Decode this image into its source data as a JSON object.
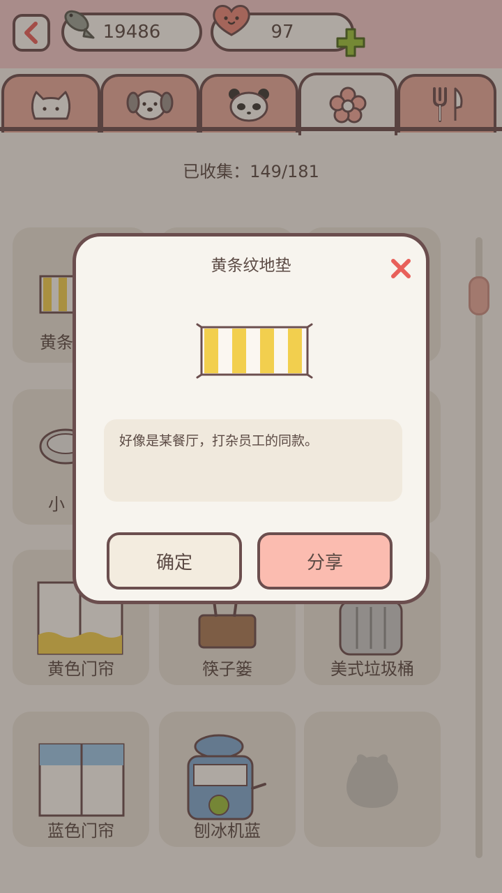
{
  "header": {
    "fish_count": "19486",
    "heart_count": "97"
  },
  "tabs": [
    {
      "icon": "cat-face-icon"
    },
    {
      "icon": "dog-face-icon"
    },
    {
      "icon": "panda-face-icon"
    },
    {
      "icon": "flower-icon",
      "active": true
    },
    {
      "icon": "fork-knife-icon"
    }
  ],
  "collection": {
    "collected_text": "已收集：149/181"
  },
  "grid": {
    "row1_col1": "黄条",
    "row2_col1": "小",
    "row3": [
      "黄色门帘",
      "筷子篓",
      "美式垃圾桶"
    ],
    "row4": [
      "蓝色门帘",
      "刨冰机蓝",
      ""
    ]
  },
  "dialog": {
    "title": "黄条纹地垫",
    "description": "好像是某餐厅，打杂员工的同款。",
    "confirm_label": "确定",
    "share_label": "分享"
  },
  "colors": {
    "accent_red": "#e8605a",
    "tab_inactive": "#e6a899",
    "stripe_yellow": "#f2cf4e",
    "share_pink": "#fbbcb0"
  }
}
